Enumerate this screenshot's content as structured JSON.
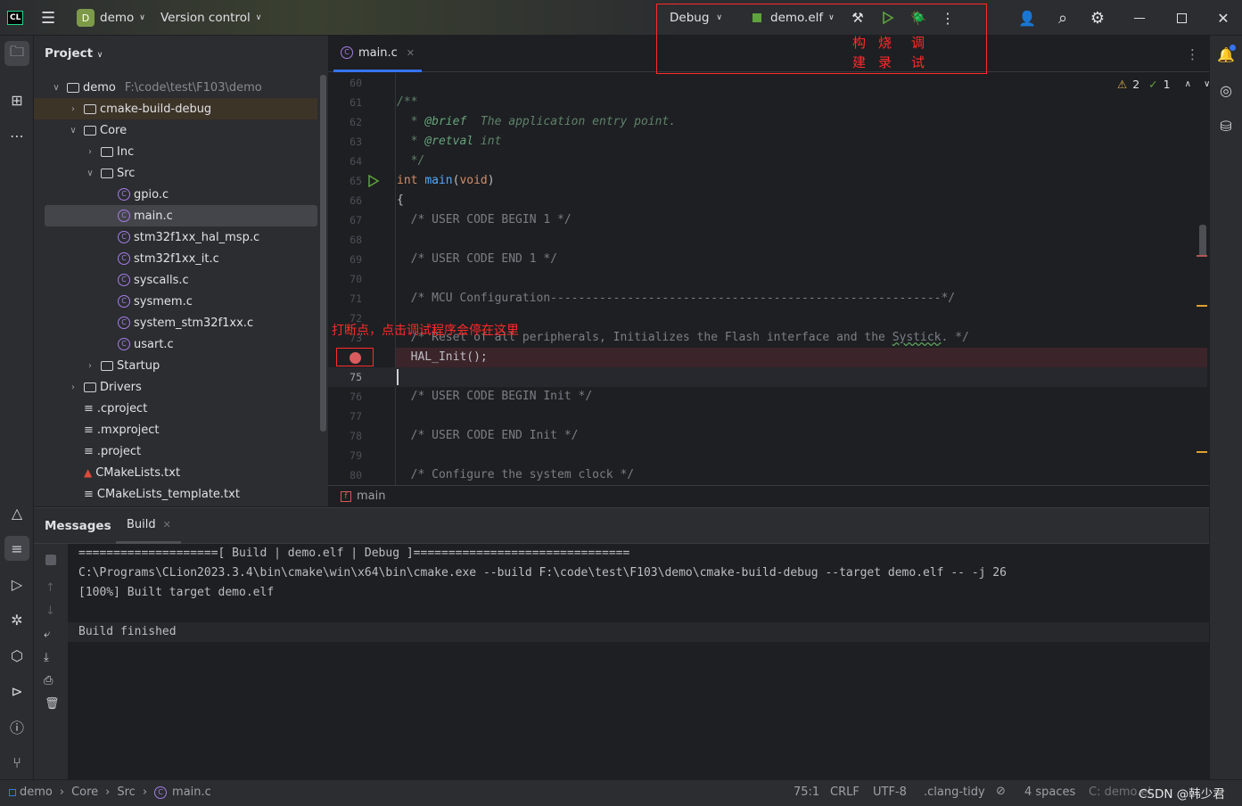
{
  "titlebar": {
    "project_badge": "D",
    "project": "demo",
    "vcs": "Version control",
    "config": "Debug",
    "target": "demo.elf"
  },
  "annotations": {
    "build": "构\n建",
    "flash": "烧\n录",
    "debug": "调\n试",
    "breakpoint": "打断点，点击调试程序会停在这里"
  },
  "project_panel": {
    "title": "Project",
    "items": [
      {
        "depth": 0,
        "label": "demo",
        "path": "F:\\code\\test\\F103\\demo",
        "type": "folder",
        "open": true
      },
      {
        "depth": 1,
        "label": "cmake-build-debug",
        "type": "folder",
        "open": false,
        "highlight": true
      },
      {
        "depth": 1,
        "label": "Core",
        "type": "folder",
        "open": true
      },
      {
        "depth": 2,
        "label": "Inc",
        "type": "folder",
        "open": false
      },
      {
        "depth": 2,
        "label": "Src",
        "type": "folder",
        "open": true
      },
      {
        "depth": 3,
        "label": "gpio.c",
        "type": "c"
      },
      {
        "depth": 3,
        "label": "main.c",
        "type": "c",
        "selected": true
      },
      {
        "depth": 3,
        "label": "stm32f1xx_hal_msp.c",
        "type": "c"
      },
      {
        "depth": 3,
        "label": "stm32f1xx_it.c",
        "type": "c"
      },
      {
        "depth": 3,
        "label": "syscalls.c",
        "type": "c"
      },
      {
        "depth": 3,
        "label": "sysmem.c",
        "type": "c"
      },
      {
        "depth": 3,
        "label": "system_stm32f1xx.c",
        "type": "c"
      },
      {
        "depth": 3,
        "label": "usart.c",
        "type": "c"
      },
      {
        "depth": 2,
        "label": "Startup",
        "type": "folder",
        "open": false
      },
      {
        "depth": 1,
        "label": "Drivers",
        "type": "folder",
        "open": false
      },
      {
        "depth": 1,
        "label": ".cproject",
        "type": "text"
      },
      {
        "depth": 1,
        "label": ".mxproject",
        "type": "text"
      },
      {
        "depth": 1,
        "label": ".project",
        "type": "text"
      },
      {
        "depth": 1,
        "label": "CMakeLists.txt",
        "type": "cmake"
      },
      {
        "depth": 1,
        "label": "CMakeLists_template.txt",
        "type": "text"
      }
    ]
  },
  "editor": {
    "tab": "main.c",
    "warnings": "2",
    "typos": "1",
    "breadcrumb_fn": "main",
    "current_line": 75,
    "breakpoint_line": 74,
    "lines": [
      {
        "n": "60",
        "s": []
      },
      {
        "n": "61",
        "s": [
          {
            "t": "/**",
            "c": "doc"
          }
        ]
      },
      {
        "n": "62",
        "s": [
          {
            "t": "  * ",
            "c": "doc"
          },
          {
            "t": "@brief",
            "c": "doctag"
          },
          {
            "t": "  The application entry point.",
            "c": "doc"
          }
        ]
      },
      {
        "n": "63",
        "s": [
          {
            "t": "  * ",
            "c": "doc"
          },
          {
            "t": "@retval",
            "c": "doctag"
          },
          {
            "t": " int",
            "c": "doc"
          }
        ]
      },
      {
        "n": "64",
        "s": [
          {
            "t": "  */",
            "c": "doc"
          }
        ]
      },
      {
        "n": "65",
        "s": [
          {
            "t": "int ",
            "c": "kw"
          },
          {
            "t": "main",
            "c": "fn"
          },
          {
            "t": "(",
            "c": "plain"
          },
          {
            "t": "void",
            "c": "kw"
          },
          {
            "t": ")",
            "c": "plain"
          }
        ],
        "run": true
      },
      {
        "n": "66",
        "s": [
          {
            "t": "{",
            "c": "plain"
          }
        ]
      },
      {
        "n": "67",
        "s": [
          {
            "t": "  /* USER CODE BEGIN 1 */",
            "c": "comment"
          }
        ]
      },
      {
        "n": "68",
        "s": []
      },
      {
        "n": "69",
        "s": [
          {
            "t": "  /* USER CODE END 1 */",
            "c": "comment"
          }
        ]
      },
      {
        "n": "70",
        "s": []
      },
      {
        "n": "71",
        "s": [
          {
            "t": "  /* MCU Configuration--------------------------------------------------------*/",
            "c": "comment"
          }
        ]
      },
      {
        "n": "72",
        "s": []
      },
      {
        "n": "73",
        "s": [
          {
            "t": "  /* Reset of all peripherals, Initializes the Flash interface and the ",
            "c": "comment"
          },
          {
            "t": "Systick",
            "c": "comment underline"
          },
          {
            "t": ". */",
            "c": "comment"
          }
        ]
      },
      {
        "n": "",
        "s": [
          {
            "t": "  HAL_Init();",
            "c": "plain"
          }
        ],
        "bp": true
      },
      {
        "n": "75",
        "s": []
      },
      {
        "n": "76",
        "s": [
          {
            "t": "  /* USER CODE BEGIN Init */",
            "c": "comment"
          }
        ]
      },
      {
        "n": "77",
        "s": []
      },
      {
        "n": "78",
        "s": [
          {
            "t": "  /* USER CODE END Init */",
            "c": "comment"
          }
        ]
      },
      {
        "n": "79",
        "s": []
      },
      {
        "n": "80",
        "s": [
          {
            "t": "  /* Configure the system clock */",
            "c": "comment"
          }
        ]
      }
    ]
  },
  "bottom": {
    "tabs": [
      "Messages",
      "Build"
    ],
    "output": [
      "====================[ Build | demo.elf | Debug ]===============================",
      "C:\\Programs\\CLion2023.3.4\\bin\\cmake\\win\\x64\\bin\\cmake.exe --build F:\\code\\test\\F103\\demo\\cmake-build-debug --target demo.elf -- -j 26",
      "[100%] Built target demo.elf",
      "",
      "Build finished"
    ]
  },
  "status": {
    "crumbs": [
      "demo",
      "Core",
      "Src",
      "main.c"
    ],
    "position": "75:1",
    "line_sep": "CRLF",
    "encoding": "UTF-8",
    "linter": ".clang-tidy",
    "indent": "4 spaces",
    "context": "C: demo.elf | Debug",
    "watermark": "CSDN @韩少君"
  },
  "colors": {
    "accent": "#3574f0",
    "breakpoint": "#db5c5c",
    "annotation": "#ff2a2a",
    "bp_line_bg": "#3b252a"
  }
}
